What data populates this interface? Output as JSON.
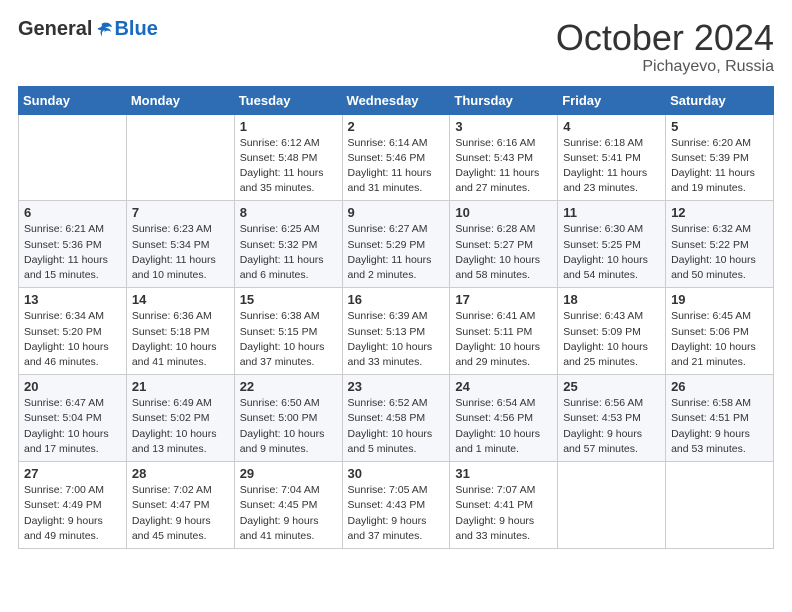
{
  "logo": {
    "general": "General",
    "blue": "Blue"
  },
  "title": "October 2024",
  "location": "Pichayevo, Russia",
  "weekdays": [
    "Sunday",
    "Monday",
    "Tuesday",
    "Wednesday",
    "Thursday",
    "Friday",
    "Saturday"
  ],
  "weeks": [
    [
      {
        "day": "",
        "info": ""
      },
      {
        "day": "",
        "info": ""
      },
      {
        "day": "1",
        "info": "Sunrise: 6:12 AM\nSunset: 5:48 PM\nDaylight: 11 hours and 35 minutes."
      },
      {
        "day": "2",
        "info": "Sunrise: 6:14 AM\nSunset: 5:46 PM\nDaylight: 11 hours and 31 minutes."
      },
      {
        "day": "3",
        "info": "Sunrise: 6:16 AM\nSunset: 5:43 PM\nDaylight: 11 hours and 27 minutes."
      },
      {
        "day": "4",
        "info": "Sunrise: 6:18 AM\nSunset: 5:41 PM\nDaylight: 11 hours and 23 minutes."
      },
      {
        "day": "5",
        "info": "Sunrise: 6:20 AM\nSunset: 5:39 PM\nDaylight: 11 hours and 19 minutes."
      }
    ],
    [
      {
        "day": "6",
        "info": "Sunrise: 6:21 AM\nSunset: 5:36 PM\nDaylight: 11 hours and 15 minutes."
      },
      {
        "day": "7",
        "info": "Sunrise: 6:23 AM\nSunset: 5:34 PM\nDaylight: 11 hours and 10 minutes."
      },
      {
        "day": "8",
        "info": "Sunrise: 6:25 AM\nSunset: 5:32 PM\nDaylight: 11 hours and 6 minutes."
      },
      {
        "day": "9",
        "info": "Sunrise: 6:27 AM\nSunset: 5:29 PM\nDaylight: 11 hours and 2 minutes."
      },
      {
        "day": "10",
        "info": "Sunrise: 6:28 AM\nSunset: 5:27 PM\nDaylight: 10 hours and 58 minutes."
      },
      {
        "day": "11",
        "info": "Sunrise: 6:30 AM\nSunset: 5:25 PM\nDaylight: 10 hours and 54 minutes."
      },
      {
        "day": "12",
        "info": "Sunrise: 6:32 AM\nSunset: 5:22 PM\nDaylight: 10 hours and 50 minutes."
      }
    ],
    [
      {
        "day": "13",
        "info": "Sunrise: 6:34 AM\nSunset: 5:20 PM\nDaylight: 10 hours and 46 minutes."
      },
      {
        "day": "14",
        "info": "Sunrise: 6:36 AM\nSunset: 5:18 PM\nDaylight: 10 hours and 41 minutes."
      },
      {
        "day": "15",
        "info": "Sunrise: 6:38 AM\nSunset: 5:15 PM\nDaylight: 10 hours and 37 minutes."
      },
      {
        "day": "16",
        "info": "Sunrise: 6:39 AM\nSunset: 5:13 PM\nDaylight: 10 hours and 33 minutes."
      },
      {
        "day": "17",
        "info": "Sunrise: 6:41 AM\nSunset: 5:11 PM\nDaylight: 10 hours and 29 minutes."
      },
      {
        "day": "18",
        "info": "Sunrise: 6:43 AM\nSunset: 5:09 PM\nDaylight: 10 hours and 25 minutes."
      },
      {
        "day": "19",
        "info": "Sunrise: 6:45 AM\nSunset: 5:06 PM\nDaylight: 10 hours and 21 minutes."
      }
    ],
    [
      {
        "day": "20",
        "info": "Sunrise: 6:47 AM\nSunset: 5:04 PM\nDaylight: 10 hours and 17 minutes."
      },
      {
        "day": "21",
        "info": "Sunrise: 6:49 AM\nSunset: 5:02 PM\nDaylight: 10 hours and 13 minutes."
      },
      {
        "day": "22",
        "info": "Sunrise: 6:50 AM\nSunset: 5:00 PM\nDaylight: 10 hours and 9 minutes."
      },
      {
        "day": "23",
        "info": "Sunrise: 6:52 AM\nSunset: 4:58 PM\nDaylight: 10 hours and 5 minutes."
      },
      {
        "day": "24",
        "info": "Sunrise: 6:54 AM\nSunset: 4:56 PM\nDaylight: 10 hours and 1 minute."
      },
      {
        "day": "25",
        "info": "Sunrise: 6:56 AM\nSunset: 4:53 PM\nDaylight: 9 hours and 57 minutes."
      },
      {
        "day": "26",
        "info": "Sunrise: 6:58 AM\nSunset: 4:51 PM\nDaylight: 9 hours and 53 minutes."
      }
    ],
    [
      {
        "day": "27",
        "info": "Sunrise: 7:00 AM\nSunset: 4:49 PM\nDaylight: 9 hours and 49 minutes."
      },
      {
        "day": "28",
        "info": "Sunrise: 7:02 AM\nSunset: 4:47 PM\nDaylight: 9 hours and 45 minutes."
      },
      {
        "day": "29",
        "info": "Sunrise: 7:04 AM\nSunset: 4:45 PM\nDaylight: 9 hours and 41 minutes."
      },
      {
        "day": "30",
        "info": "Sunrise: 7:05 AM\nSunset: 4:43 PM\nDaylight: 9 hours and 37 minutes."
      },
      {
        "day": "31",
        "info": "Sunrise: 7:07 AM\nSunset: 4:41 PM\nDaylight: 9 hours and 33 minutes."
      },
      {
        "day": "",
        "info": ""
      },
      {
        "day": "",
        "info": ""
      }
    ]
  ]
}
